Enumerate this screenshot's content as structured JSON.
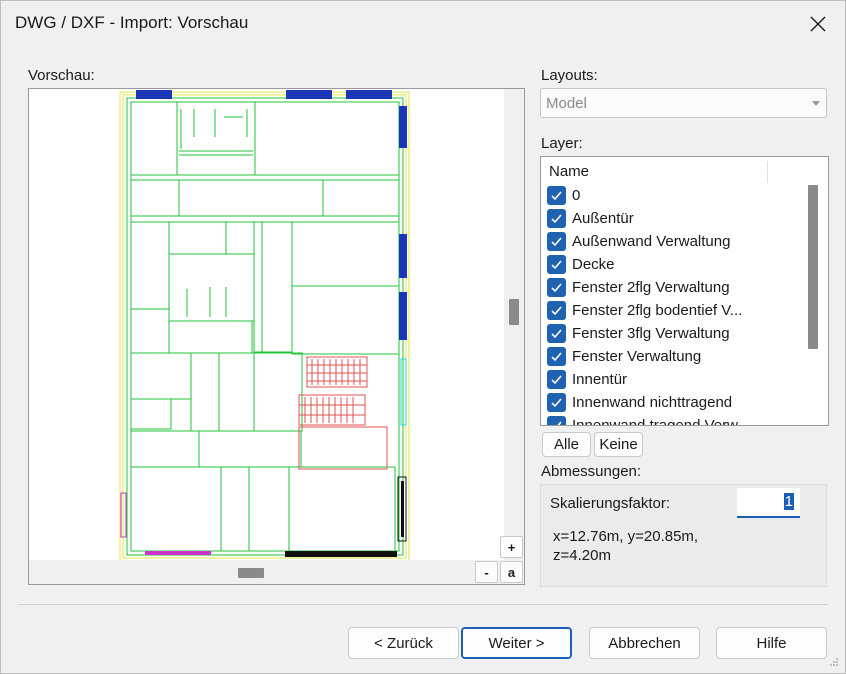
{
  "window": {
    "title": "DWG / DXF - Import: Vorschau"
  },
  "preview": {
    "label": "Vorschau:",
    "zoom_in_label": "+",
    "zoom_out_label": "-",
    "zoom_all_label": "a"
  },
  "layouts": {
    "label": "Layouts:",
    "selected": "Model"
  },
  "layers": {
    "label": "Layer:",
    "column_header": "Name",
    "items": [
      {
        "name": "0",
        "checked": true
      },
      {
        "name": "Außentür",
        "checked": true
      },
      {
        "name": "Außenwand Verwaltung",
        "checked": true
      },
      {
        "name": "Decke",
        "checked": true
      },
      {
        "name": "Fenster 2flg Verwaltung",
        "checked": true
      },
      {
        "name": "Fenster 2flg bodentief  V...",
        "checked": true
      },
      {
        "name": "Fenster 3flg Verwaltung",
        "checked": true
      },
      {
        "name": "Fenster Verwaltung",
        "checked": true
      },
      {
        "name": "Innentür",
        "checked": true
      },
      {
        "name": "Innenwand nichttragend",
        "checked": true
      },
      {
        "name": "Innenwand tragend Verw...",
        "checked": true
      }
    ],
    "all_button": "Alle",
    "none_button": "Keine"
  },
  "dimensions": {
    "label": "Abmessungen:",
    "scale_label": "Skalierungsfaktor:",
    "scale_value": "1",
    "extent_line1": "x=12.76m, y=20.85m,",
    "extent_line2": "z=4.20m"
  },
  "footer": {
    "back_button": "< Zurück",
    "next_button": "Weiter >",
    "cancel_button": "Abbrechen",
    "help_button": "Hilfe"
  },
  "colors": {
    "accent": "#1a5fb4",
    "checkbox": "#1f62b0",
    "wall_green": "#22c33a",
    "outline_yellow": "#e5e54a",
    "window_blue": "#1c36b8",
    "stair_red": "#e05050",
    "magenta": "#cc33cc",
    "cyan": "#22d4e0"
  }
}
